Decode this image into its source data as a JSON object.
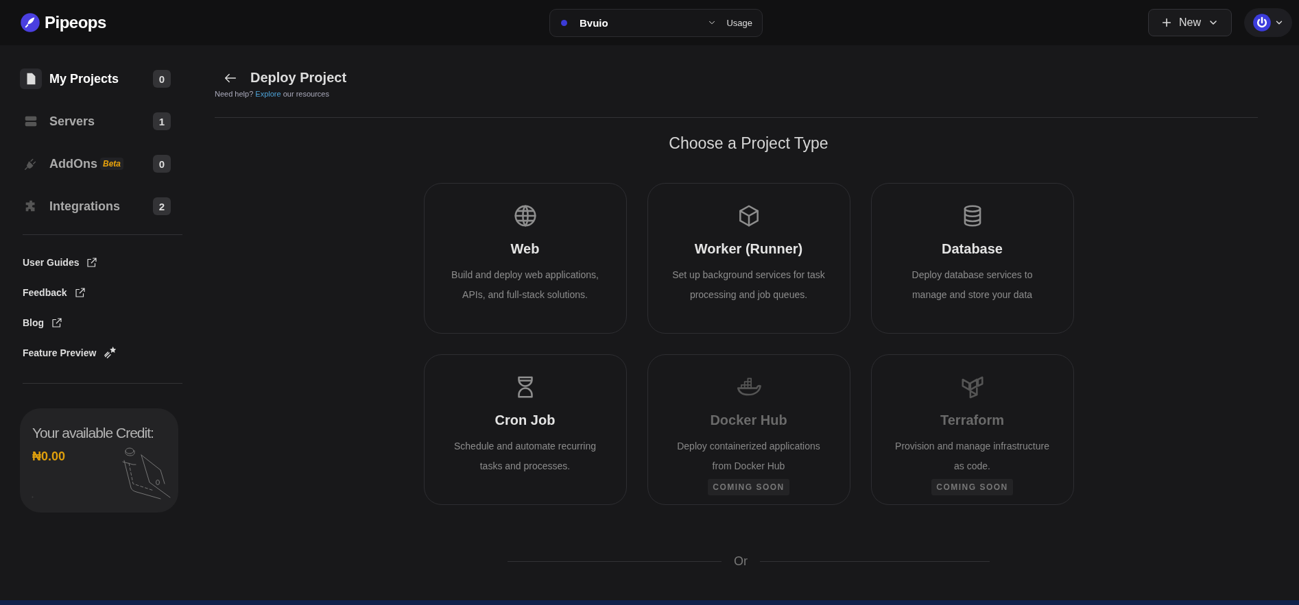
{
  "brand": {
    "name": "Pipeops"
  },
  "workspace": {
    "name": "Bvuio",
    "usage_label": "Usage"
  },
  "new_button": {
    "label": "New"
  },
  "sidebar": {
    "items": [
      {
        "label": "My Projects",
        "count": "0",
        "selected": true
      },
      {
        "label": "Servers",
        "count": "1",
        "selected": false
      },
      {
        "label": "AddOns",
        "badge": "Beta",
        "count": "0",
        "selected": false
      },
      {
        "label": "Integrations",
        "count": "2",
        "selected": false
      }
    ],
    "links": [
      {
        "label": "User Guides",
        "kind": "external"
      },
      {
        "label": "Feedback",
        "kind": "external"
      },
      {
        "label": "Blog",
        "kind": "external"
      },
      {
        "label": "Feature Preview",
        "kind": "preview"
      }
    ],
    "credit": {
      "title": "Your available Credit:",
      "amount": "₦0.00"
    }
  },
  "page": {
    "title": "Deploy Project",
    "help_text": "Need help?",
    "help_link": "Explore",
    "help_suffix": "our resources"
  },
  "project_types": {
    "heading": "Choose a Project Type",
    "cards": [
      {
        "title": "Web",
        "description": "Build and deploy web applications, APIs, and full-stack solutions.",
        "disabled": false
      },
      {
        "title": "Worker (Runner)",
        "description": "Set up background services for task processing and job queues.",
        "disabled": false
      },
      {
        "title": "Database",
        "description": "Deploy database services to manage and store your data",
        "disabled": false
      },
      {
        "title": "Cron Job",
        "description": "Schedule and automate recurring tasks and processes.",
        "disabled": false
      },
      {
        "title": "Docker Hub",
        "description": "Deploy containerized applications from Docker Hub",
        "disabled": true,
        "badge": "COMING SOON"
      },
      {
        "title": "Terraform",
        "description": "Provision and manage infrastructure as code.",
        "disabled": true,
        "badge": "COMING SOON"
      }
    ]
  },
  "divider_label": "Or"
}
